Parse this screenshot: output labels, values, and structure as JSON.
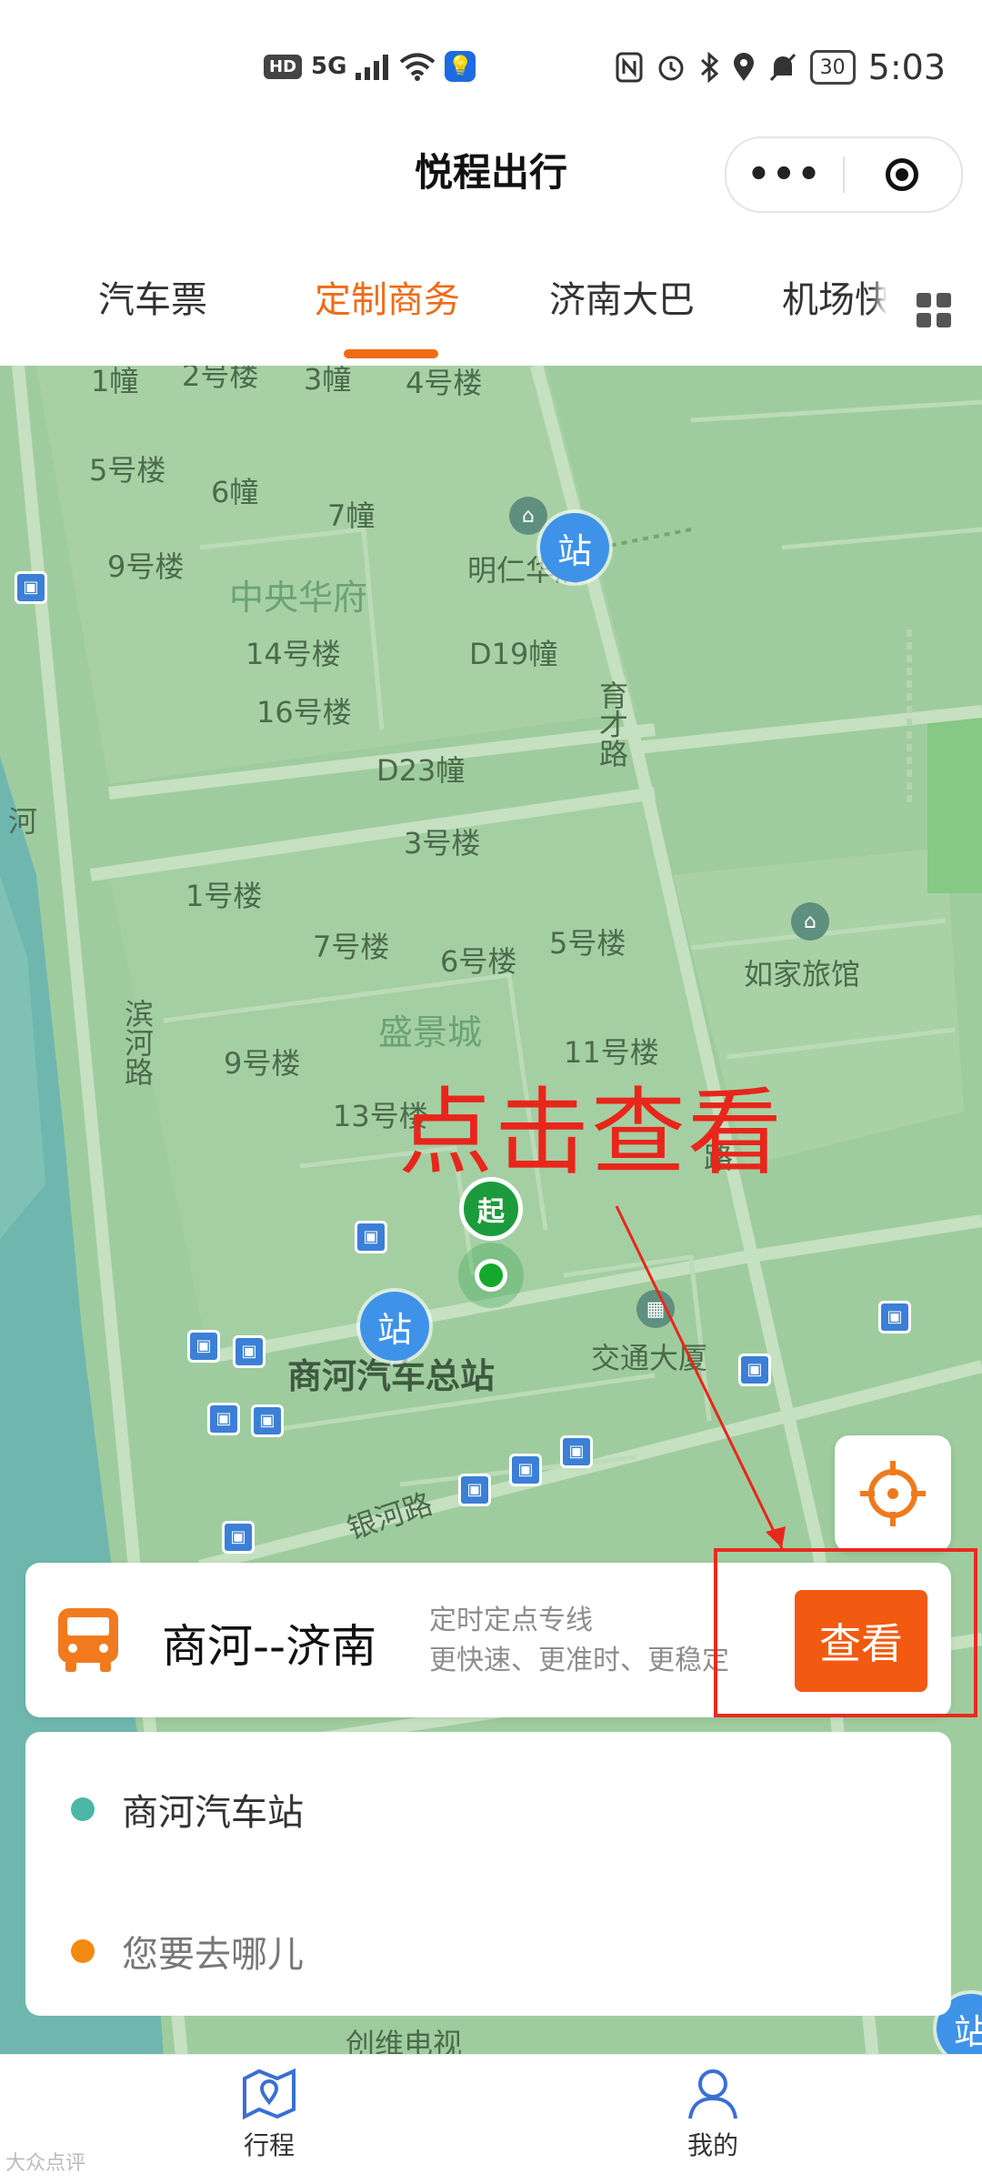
{
  "status_bar": {
    "left_badges": [
      "HD",
      "5G"
    ],
    "battery": "30",
    "time": "5:03",
    "icons": [
      "signal-icon",
      "wifi-icon",
      "bulb-icon",
      "nfc-icon",
      "alarm-icon",
      "bluetooth-icon",
      "location-icon",
      "mute-icon",
      "battery-icon"
    ]
  },
  "header": {
    "title": "悦程出行",
    "more_label": "•••"
  },
  "tabs": [
    {
      "label": "汽车票",
      "active": false
    },
    {
      "label": "定制商务",
      "active": true
    },
    {
      "label": "济南大巴",
      "active": false
    },
    {
      "label": "机场快",
      "active": false
    }
  ],
  "accent_color": "#ef6c16",
  "map": {
    "labels": {
      "b1": "1幢",
      "b2": "2号楼",
      "b3": "3幢",
      "b4": "4号楼",
      "b5": "5号楼",
      "b6": "6幢",
      "b7": "7幢",
      "b9": "9号楼",
      "mingren": "明仁华府",
      "zhongyang": "中央华府",
      "b14": "14号楼",
      "d19": "D19幢",
      "yucai": "育才路",
      "b16": "16号楼",
      "d23": "D23幢",
      "b3b": "3号楼",
      "b1b": "1号楼",
      "b7b": "7号楼",
      "b6b": "6号楼",
      "b5b": "5号楼",
      "rujia": "如家旅馆",
      "binhe": "滨河路",
      "shengjing": "盛景城",
      "b9b": "9号楼",
      "b11": "11号楼",
      "b13": "13号楼",
      "jiaotong": "交通大厦",
      "shanghe_station": "商河汽车总站",
      "yinhe": "银河路",
      "chuangwei": "创维电视",
      "hebi": "河",
      "lubi": "路"
    },
    "station_label": "站",
    "start_label": "起",
    "annotation": "点击查看"
  },
  "route_card": {
    "name": "商河--济南",
    "desc_line1": "定时定点专线",
    "desc_line2": "更快速、更准时、更稳定",
    "button": "查看"
  },
  "locations": {
    "from": "商河汽车站",
    "to_placeholder": "您要去哪儿",
    "from_color": "#4cb7a5",
    "to_color": "#f28a12"
  },
  "bottom_nav": [
    {
      "label": "行程",
      "icon": "map-icon"
    },
    {
      "label": "我的",
      "icon": "user-icon"
    }
  ],
  "watermark": "大众点评"
}
